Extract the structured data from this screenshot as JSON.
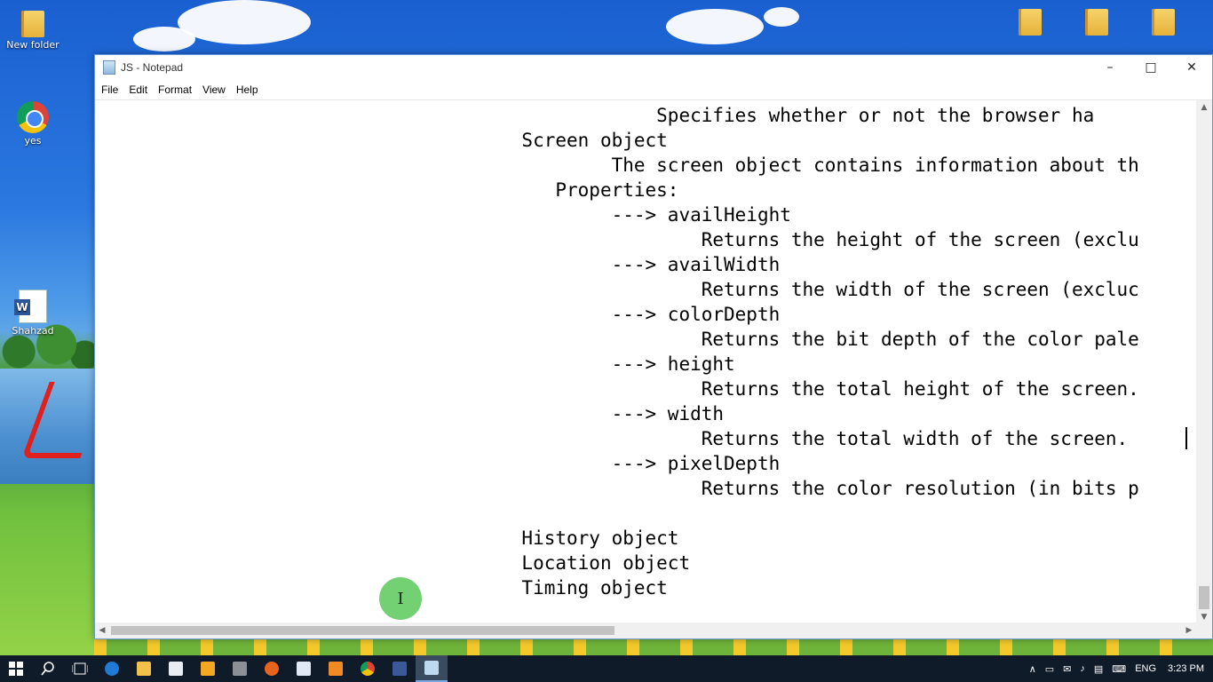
{
  "desktop": {
    "icons": [
      {
        "label": "New folder"
      },
      {
        "label": "yes"
      },
      {
        "label": "Shahzad"
      }
    ]
  },
  "window": {
    "title": "JS - Notepad",
    "controls": {
      "minimize": "–",
      "maximize": "□",
      "close": "✕"
    },
    "menu": [
      "File",
      "Edit",
      "Format",
      "View",
      "Help"
    ]
  },
  "editor": {
    "lines": [
      "                                                  Specifies whether or not the browser ha",
      "                                      Screen object",
      "                                              The screen object contains information about th",
      "                                         Properties:",
      "                                              ---> availHeight",
      "                                                      Returns the height of the screen (exclu",
      "                                              ---> availWidth",
      "                                                      Returns the width of the screen (excluc",
      "                                              ---> colorDepth",
      "                                                      Returns the bit depth of the color pale",
      "                                              ---> height",
      "                                                      Returns the total height of the screen.",
      "                                              ---> width",
      "                                                      Returns the total width of the screen.",
      "                                              ---> pixelDepth",
      "                                                      Returns the color resolution (in bits p",
      "",
      "                                      History object",
      "                                      Location object",
      "                                      Timing object"
    ]
  },
  "cursor": {
    "glyph": "I"
  },
  "taskbar": {
    "icons": [
      "start-icon",
      "search-icon",
      "task-view-icon",
      "edge-icon",
      "file-explorer-icon",
      "store-icon",
      "media-player-icon",
      "video-editor-icon",
      "firefox-icon",
      "outlook-icon",
      "paint-icon",
      "chrome-icon",
      "facebook-icon",
      "notepad-icon"
    ],
    "tray": {
      "chevron": "∧",
      "battery": "▭",
      "network": "✉",
      "volume": "♪",
      "notifications": "▤",
      "keyboard": "⌨",
      "language": "ENG",
      "time": "3:23 PM"
    }
  }
}
